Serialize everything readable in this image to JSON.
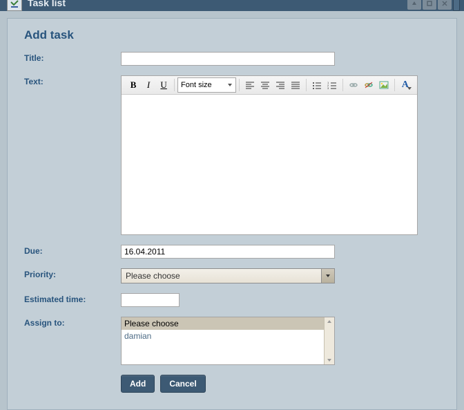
{
  "header": {
    "title": "Task list"
  },
  "page": {
    "heading": "Add task",
    "labels": {
      "title": "Title:",
      "text": "Text:",
      "due": "Due:",
      "priority": "Priority:",
      "estimated": "Estimated time:",
      "assign": "Assign to:"
    }
  },
  "editor": {
    "font_size_label": "Font size"
  },
  "fields": {
    "title_value": "",
    "due_value": "16.04.2011",
    "priority_value": "Please choose",
    "estimated_value": "",
    "assign_options": [
      "Please choose",
      "damian"
    ],
    "assign_selected_index": 0
  },
  "buttons": {
    "add": "Add",
    "cancel": "Cancel"
  }
}
